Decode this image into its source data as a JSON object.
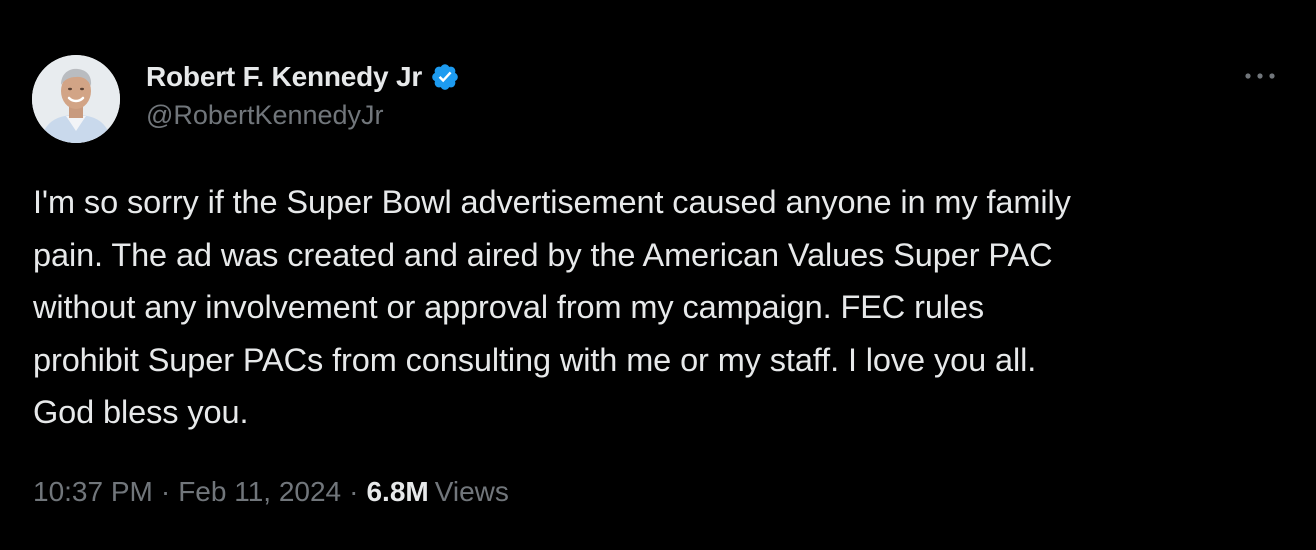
{
  "tweet": {
    "author": {
      "display_name": "Robert F. Kennedy Jr",
      "handle": "@RobertKennedyJr",
      "verified_icon": "verified-badge-icon",
      "verified_color": "#1d9bf0"
    },
    "more_icon": "more-horizontal-icon",
    "text": "I'm so sorry if the Super Bowl advertisement caused anyone in my family\npain. The ad was created and aired by the American Values Super PAC\nwithout any involvement or approval from my campaign. FEC rules\nprohibit Super PACs from consulting with me or my staff. I love you all.\nGod bless you.",
    "meta": {
      "time": "10:37 PM",
      "separator": "·",
      "date": "Feb 11, 2024",
      "views_count": "6.8M",
      "views_label": "Views"
    }
  },
  "colors": {
    "background": "#000000",
    "text_primary": "#e7e9ea",
    "text_secondary": "#71767b",
    "accent": "#1d9bf0"
  }
}
